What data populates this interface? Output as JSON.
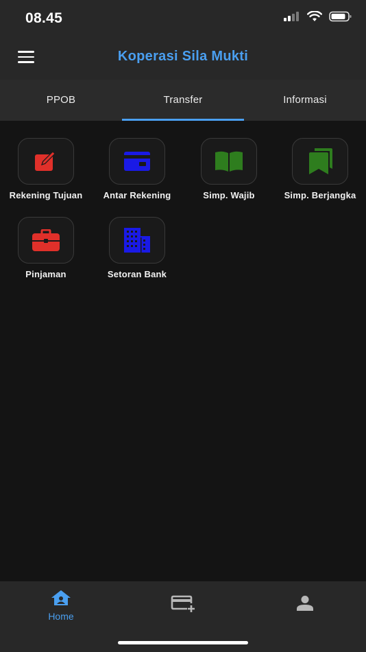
{
  "status_bar": {
    "time": "08.45"
  },
  "app_bar": {
    "title": "Koperasi Sila Mukti"
  },
  "tabs": [
    {
      "label": "PPOB",
      "active": false
    },
    {
      "label": "Transfer",
      "active": true
    },
    {
      "label": "Informasi",
      "active": false
    }
  ],
  "menu": [
    {
      "label": "Rekening Tujuan",
      "icon": "edit-square-icon",
      "color": "#e0302a"
    },
    {
      "label": "Antar Rekening",
      "icon": "credit-card-icon",
      "color": "#1a1ae6"
    },
    {
      "label": "Simp. Wajib",
      "icon": "open-book-icon",
      "color": "#2e7d1e"
    },
    {
      "label": "Simp. Berjangka",
      "icon": "bookmarks-icon",
      "color": "#2e7d1e"
    },
    {
      "label": "Pinjaman",
      "icon": "briefcase-icon",
      "color": "#e0302a"
    },
    {
      "label": "Setoran Bank",
      "icon": "building-icon",
      "color": "#1a1ae6"
    }
  ],
  "bottom_nav": {
    "home_label": "Home",
    "accent": "#4a9ff0",
    "items": [
      "home-icon",
      "add-card-icon",
      "person-icon"
    ]
  }
}
